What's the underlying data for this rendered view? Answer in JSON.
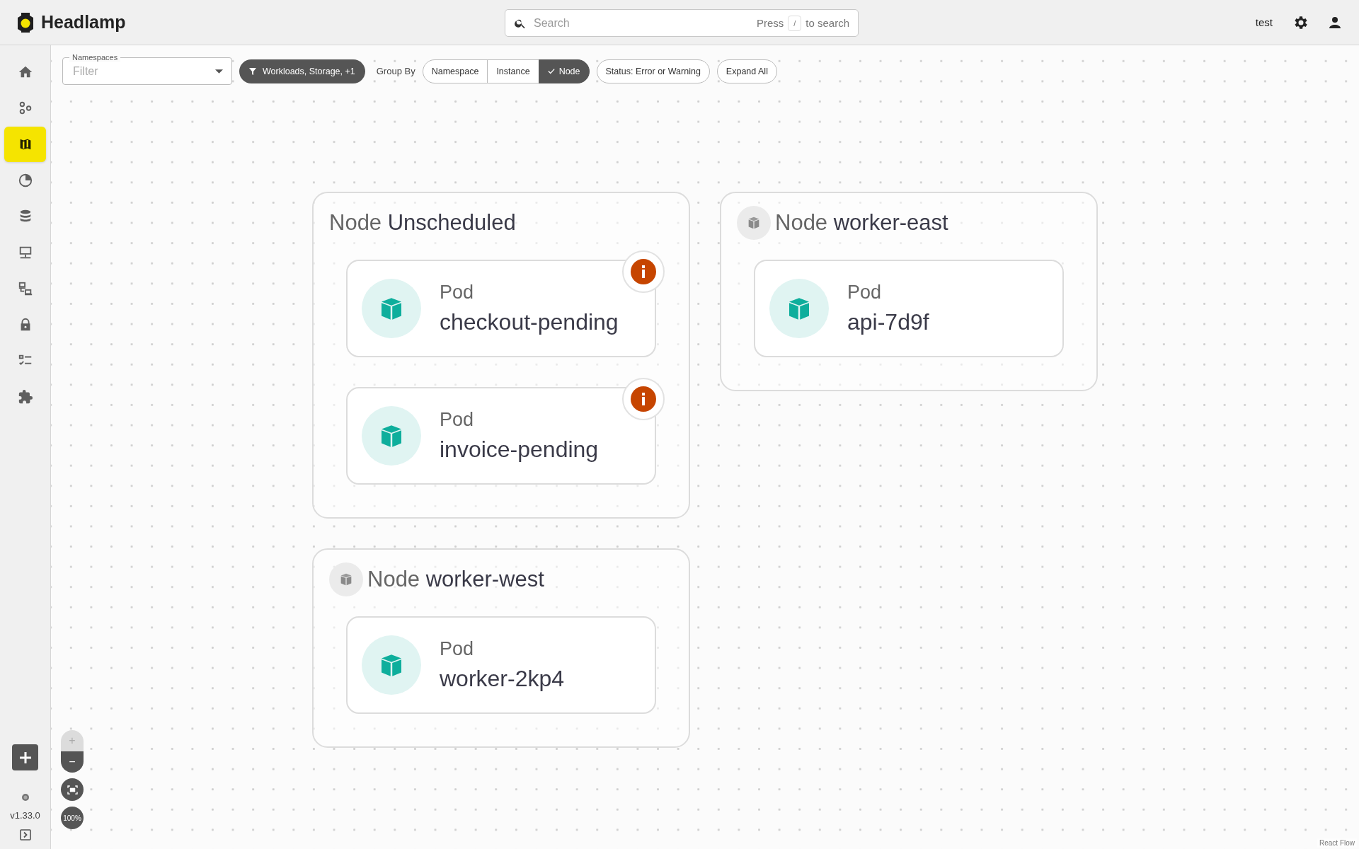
{
  "app": {
    "title": "Headlamp"
  },
  "search": {
    "placeholder": "Search",
    "hint_before": "Press",
    "key": "/",
    "hint_after": "to search"
  },
  "user": {
    "name": "test"
  },
  "sidebar": {
    "items": [
      {
        "kind": "home",
        "selected": false
      },
      {
        "kind": "cluster",
        "selected": false
      },
      {
        "kind": "map",
        "selected": true
      },
      {
        "kind": "chart",
        "selected": false
      },
      {
        "kind": "storage",
        "selected": false
      },
      {
        "kind": "network",
        "selected": false
      },
      {
        "kind": "gateway",
        "selected": false
      },
      {
        "kind": "security",
        "selected": false
      },
      {
        "kind": "checklist",
        "selected": false
      },
      {
        "kind": "plugin",
        "selected": false
      }
    ],
    "version": "v1.33.0"
  },
  "toolbar": {
    "namespaces": {
      "label": "Namespaces",
      "placeholder": "Filter"
    },
    "filter_chip": "Workloads, Storage, +1",
    "group_by": {
      "label": "Group By",
      "options": [
        {
          "label": "Namespace",
          "selected": false
        },
        {
          "label": "Instance",
          "selected": false
        },
        {
          "label": "Node",
          "selected": true
        }
      ]
    },
    "status_button": "Status: Error or Warning",
    "expand_button": "Expand All"
  },
  "groups": [
    {
      "kind_label": "Node",
      "name": "Unscheduled",
      "has_icon": false,
      "pods": [
        {
          "kind_label": "Pod",
          "name": "checkout-pending",
          "alert": true
        },
        {
          "kind_label": "Pod",
          "name": "invoice-pending",
          "alert": true
        }
      ]
    },
    {
      "kind_label": "Node",
      "name": "worker-east",
      "has_icon": true,
      "pods": [
        {
          "kind_label": "Pod",
          "name": "api-7d9f",
          "alert": false
        }
      ]
    },
    {
      "kind_label": "Node",
      "name": "worker-west",
      "has_icon": true,
      "pods": [
        {
          "kind_label": "Pod",
          "name": "worker-2kp4",
          "alert": false
        }
      ]
    }
  ],
  "zoom_controls": {
    "zoom_in": "+",
    "zoom_in_disabled": true,
    "zoom_out": "−",
    "zoom_level": "100%"
  },
  "attribution": "React Flow"
}
